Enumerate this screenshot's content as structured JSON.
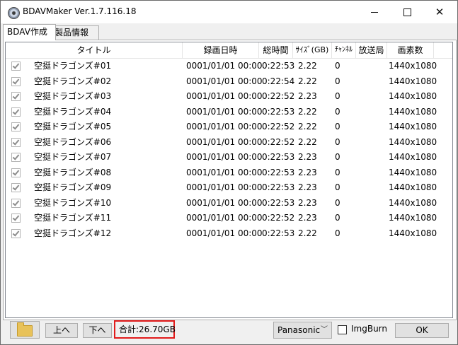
{
  "window": {
    "title": "BDAVMaker Ver.1.7.116.18",
    "min_symbol": "",
    "close_symbol": "✕"
  },
  "tabs": [
    {
      "label": "BDAV作成",
      "active": true
    },
    {
      "label": "製品情報",
      "active": false
    }
  ],
  "table": {
    "columns": [
      "タイトル",
      "録画日時",
      "総時間",
      "ｻｲｽﾞ(GB)",
      "ﾁｬﾝﾈﾙ",
      "放送局",
      "画素数"
    ],
    "rows": [
      {
        "checked": true,
        "title": "空挺ドラゴンズ#01",
        "date": "0001/01/01 00:00",
        "duration": "0:22:53",
        "size": "2.22",
        "channel": "0",
        "station": "",
        "resolution": "1440x1080"
      },
      {
        "checked": true,
        "title": "空挺ドラゴンズ#02",
        "date": "0001/01/01 00:00",
        "duration": "0:22:54",
        "size": "2.22",
        "channel": "0",
        "station": "",
        "resolution": "1440x1080"
      },
      {
        "checked": true,
        "title": "空挺ドラゴンズ#03",
        "date": "0001/01/01 00:00",
        "duration": "0:22:52",
        "size": "2.23",
        "channel": "0",
        "station": "",
        "resolution": "1440x1080"
      },
      {
        "checked": true,
        "title": "空挺ドラゴンズ#04",
        "date": "0001/01/01 00:00",
        "duration": "0:22:53",
        "size": "2.22",
        "channel": "0",
        "station": "",
        "resolution": "1440x1080"
      },
      {
        "checked": true,
        "title": "空挺ドラゴンズ#05",
        "date": "0001/01/01 00:00",
        "duration": "0:22:52",
        "size": "2.22",
        "channel": "0",
        "station": "",
        "resolution": "1440x1080"
      },
      {
        "checked": true,
        "title": "空挺ドラゴンズ#06",
        "date": "0001/01/01 00:00",
        "duration": "0:22:52",
        "size": "2.22",
        "channel": "0",
        "station": "",
        "resolution": "1440x1080"
      },
      {
        "checked": true,
        "title": "空挺ドラゴンズ#07",
        "date": "0001/01/01 00:00",
        "duration": "0:22:53",
        "size": "2.23",
        "channel": "0",
        "station": "",
        "resolution": "1440x1080"
      },
      {
        "checked": true,
        "title": "空挺ドラゴンズ#08",
        "date": "0001/01/01 00:00",
        "duration": "0:22:53",
        "size": "2.23",
        "channel": "0",
        "station": "",
        "resolution": "1440x1080"
      },
      {
        "checked": true,
        "title": "空挺ドラゴンズ#09",
        "date": "0001/01/01 00:00",
        "duration": "0:22:53",
        "size": "2.23",
        "channel": "0",
        "station": "",
        "resolution": "1440x1080"
      },
      {
        "checked": true,
        "title": "空挺ドラゴンズ#10",
        "date": "0001/01/01 00:00",
        "duration": "0:22:53",
        "size": "2.23",
        "channel": "0",
        "station": "",
        "resolution": "1440x1080"
      },
      {
        "checked": true,
        "title": "空挺ドラゴンズ#11",
        "date": "0001/01/01 00:00",
        "duration": "0:22:52",
        "size": "2.23",
        "channel": "0",
        "station": "",
        "resolution": "1440x1080"
      },
      {
        "checked": true,
        "title": "空挺ドラゴンズ#12",
        "date": "0001/01/01 00:00",
        "duration": "0:22:53",
        "size": "2.22",
        "channel": "0",
        "station": "",
        "resolution": "1440x1080"
      }
    ]
  },
  "bottom": {
    "folder_icon": "folder-icon",
    "up_label": "上へ",
    "down_label": "下へ",
    "total": "合計:26.70GB",
    "maker_select": "Panasonic",
    "imgburn_label": "ImgBurn",
    "imgburn_checked": false,
    "ok_label": "OK",
    "highlight_color": "#e21b1b"
  }
}
